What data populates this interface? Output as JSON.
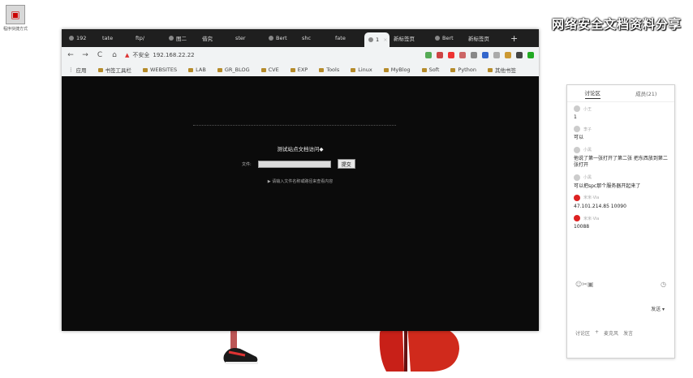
{
  "desktop": {
    "icon_caption": "程序快捷方式",
    "watermark": "网络安全文档资料分享"
  },
  "browser": {
    "tabs": [
      {
        "label": "192"
      },
      {
        "label": "tate"
      },
      {
        "label": "ftp/"
      },
      {
        "label": "图二"
      },
      {
        "label": "借究"
      },
      {
        "label": "ster"
      },
      {
        "label": "Bert"
      },
      {
        "label": "shc"
      },
      {
        "label": "fate"
      },
      {
        "label": "1"
      },
      {
        "label": "新标签页"
      },
      {
        "label": "Bert"
      },
      {
        "label": "新标签页"
      }
    ],
    "new_tab": "+",
    "nav": {
      "back": "←",
      "forward": "→",
      "reload": "C",
      "home": "⌂"
    },
    "address": {
      "security": "不安全",
      "url": "192.168.22.22"
    },
    "bookmarks": [
      {
        "label": "应用"
      },
      {
        "label": "书签工具栏"
      },
      {
        "label": "WEBSITES"
      },
      {
        "label": "LAB"
      },
      {
        "label": "GR_BLOG"
      },
      {
        "label": "CVE"
      },
      {
        "label": "EXP"
      },
      {
        "label": "Tools"
      },
      {
        "label": "Linux"
      },
      {
        "label": "MyBlog"
      },
      {
        "label": "Soft"
      },
      {
        "label": "Python"
      },
      {
        "label": "其他书签"
      }
    ],
    "page": {
      "title": "测试站点文档访问◆",
      "input_label": "文件:",
      "input_value": "",
      "submit": "提交",
      "note": "▶ 请输入文件名称或路径来查看内容"
    }
  },
  "panel": {
    "tabs": [
      {
        "label": "讨论区"
      },
      {
        "label": "成员(21)"
      }
    ],
    "messages": [
      {
        "user": "小王",
        "text": "1"
      },
      {
        "user": "李子",
        "text": "可以"
      },
      {
        "user": "小黑",
        "text": "他说了第一张打开了第二张 把东西放到第二张打开"
      },
      {
        "user": "小黑",
        "text": "可以把spc那个服务器开起来了"
      },
      {
        "user": "米米·Via",
        "text": "47.101.214.85 10090"
      },
      {
        "user": "米米·Via",
        "text": "10088"
      }
    ],
    "send_label": "发送",
    "bottom_items": [
      "讨论区",
      "+",
      "麦克风",
      "发言"
    ]
  }
}
